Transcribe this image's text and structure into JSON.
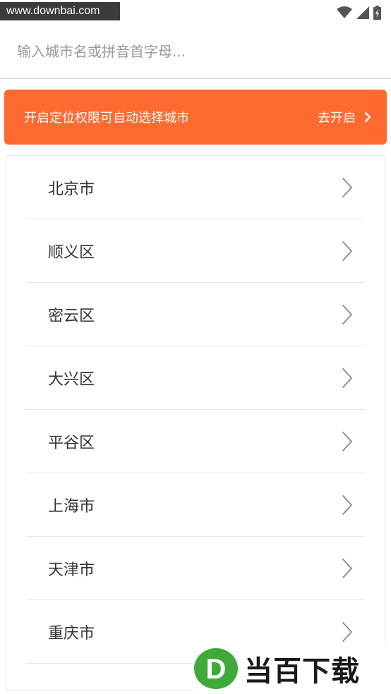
{
  "watermark": {
    "site": "www.downbai.com",
    "brand": "当百下载",
    "logo_letter": "D"
  },
  "status_bar": {
    "icons": [
      "wifi-icon",
      "signal-icon",
      "battery-charging-icon"
    ]
  },
  "search": {
    "placeholder": "输入城市名或拼音首字母..."
  },
  "location_banner": {
    "text": "开启定位权限可自动选择城市",
    "action_label": "去开启",
    "bg_color": "#ff6a30"
  },
  "cities": [
    "北京市",
    "顺义区",
    "密云区",
    "大兴区",
    "平谷区",
    "上海市",
    "天津市",
    "重庆市"
  ]
}
